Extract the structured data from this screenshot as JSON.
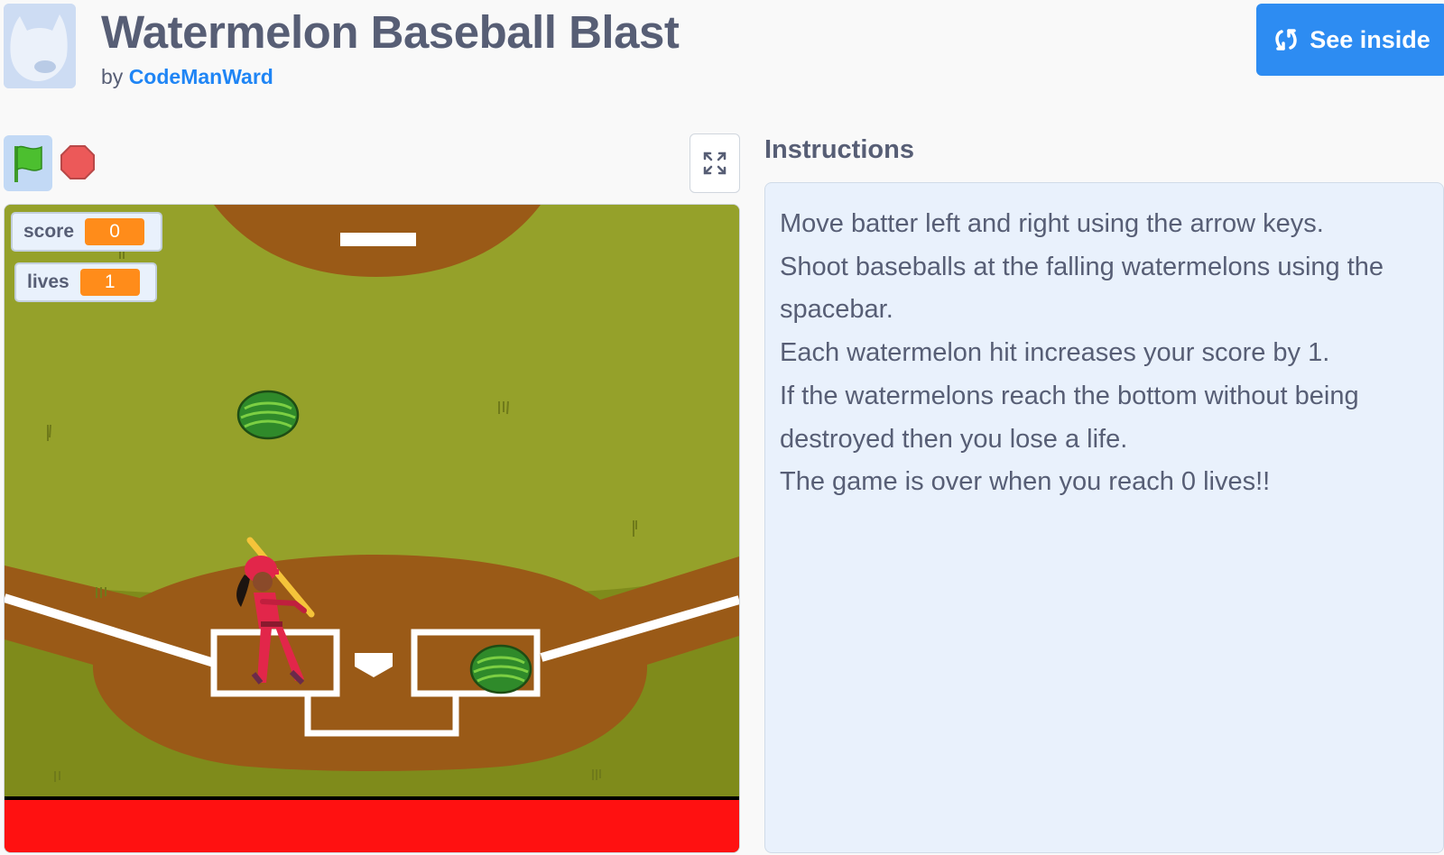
{
  "header": {
    "title": "Watermelon Baseball Blast",
    "by_label": "by",
    "author": "CodeManWard",
    "see_inside_label": "See inside",
    "see_inside_icon": "remix-icon"
  },
  "controls": {
    "green_flag_icon": "green-flag-icon",
    "stop_icon": "stop-sign-icon",
    "fullscreen_icon": "fullscreen-icon"
  },
  "stage": {
    "monitors": [
      {
        "label": "score",
        "value": "0"
      },
      {
        "label": "lives",
        "value": "1"
      }
    ],
    "sprites": [
      "watermelon",
      "watermelon",
      "batter"
    ]
  },
  "instructions": {
    "title": "Instructions",
    "lines": [
      "Move batter left and right using the arrow keys.",
      "Shoot baseballs at the falling watermelons using the",
      "spacebar.",
      "Each watermelon hit increases your score by 1.",
      "If the watermelons reach the bottom without being",
      "destroyed then you lose a life.",
      "The game is over when you reach 0 lives!!"
    ]
  },
  "colors": {
    "accent": "#2d8cf2",
    "author_link": "#1f85f5",
    "monitor_value": "#ff8c1a",
    "grass": "#95a12a",
    "dirt": "#9a5a17",
    "danger_bar": "#ff1111"
  }
}
